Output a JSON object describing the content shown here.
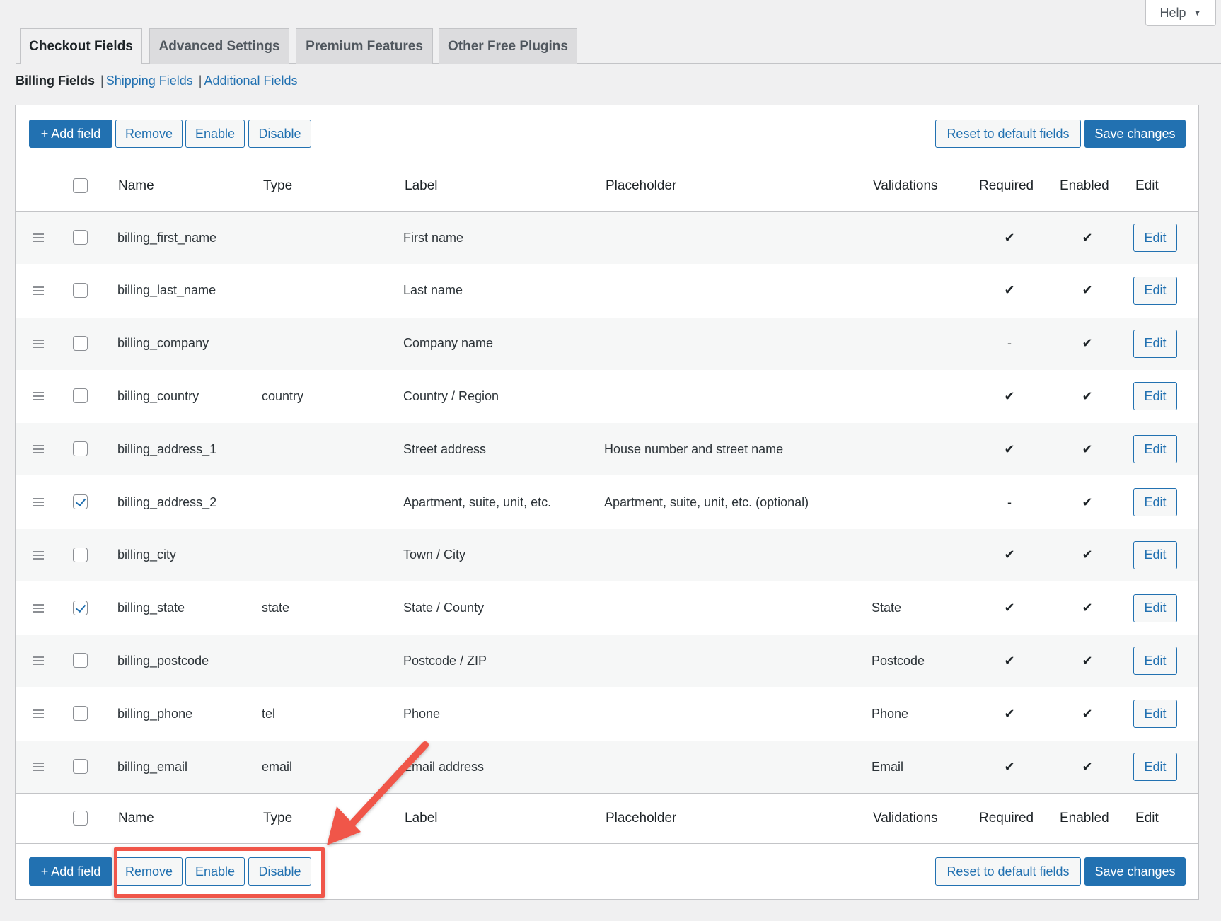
{
  "help": {
    "label": "Help",
    "caret": "▼"
  },
  "tabs": [
    {
      "label": "Checkout Fields",
      "active": true
    },
    {
      "label": "Advanced Settings",
      "active": false
    },
    {
      "label": "Premium Features",
      "active": false
    },
    {
      "label": "Other Free Plugins",
      "active": false
    }
  ],
  "subnav": {
    "current": "Billing Fields",
    "separator": "|",
    "links": [
      "Shipping Fields",
      "Additional Fields"
    ]
  },
  "toolbar": {
    "add_field": "+ Add field",
    "remove": "Remove",
    "enable": "Enable",
    "disable": "Disable",
    "reset": "Reset to default fields",
    "save": "Save changes"
  },
  "columns": [
    "Name",
    "Type",
    "Label",
    "Placeholder",
    "Validations",
    "Required",
    "Enabled",
    "Edit"
  ],
  "edit_label": "Edit",
  "rows": [
    {
      "name": "billing_first_name",
      "type": "",
      "label": "First name",
      "placeholder": "",
      "validations": "",
      "required": "✔",
      "enabled": "✔",
      "checked": false
    },
    {
      "name": "billing_last_name",
      "type": "",
      "label": "Last name",
      "placeholder": "",
      "validations": "",
      "required": "✔",
      "enabled": "✔",
      "checked": false
    },
    {
      "name": "billing_company",
      "type": "",
      "label": "Company name",
      "placeholder": "",
      "validations": "",
      "required": "-",
      "enabled": "✔",
      "checked": false
    },
    {
      "name": "billing_country",
      "type": "country",
      "label": "Country / Region",
      "placeholder": "",
      "validations": "",
      "required": "✔",
      "enabled": "✔",
      "checked": false
    },
    {
      "name": "billing_address_1",
      "type": "",
      "label": "Street address",
      "placeholder": "House number and street name",
      "validations": "",
      "required": "✔",
      "enabled": "✔",
      "checked": false
    },
    {
      "name": "billing_address_2",
      "type": "",
      "label": "Apartment, suite, unit, etc.",
      "placeholder": "Apartment, suite, unit, etc. (optional)",
      "validations": "",
      "required": "-",
      "enabled": "✔",
      "checked": true
    },
    {
      "name": "billing_city",
      "type": "",
      "label": "Town / City",
      "placeholder": "",
      "validations": "",
      "required": "✔",
      "enabled": "✔",
      "checked": false
    },
    {
      "name": "billing_state",
      "type": "state",
      "label": "State / County",
      "placeholder": "",
      "validations": "State",
      "required": "✔",
      "enabled": "✔",
      "checked": true
    },
    {
      "name": "billing_postcode",
      "type": "",
      "label": "Postcode / ZIP",
      "placeholder": "",
      "validations": "Postcode",
      "required": "✔",
      "enabled": "✔",
      "checked": false
    },
    {
      "name": "billing_phone",
      "type": "tel",
      "label": "Phone",
      "placeholder": "",
      "validations": "Phone",
      "required": "✔",
      "enabled": "✔",
      "checked": false
    },
    {
      "name": "billing_email",
      "type": "email",
      "label": "Email address",
      "placeholder": "",
      "validations": "Email",
      "required": "✔",
      "enabled": "✔",
      "checked": false
    }
  ],
  "colors": {
    "primary": "#2271b1",
    "annotation": "#f0564a"
  }
}
